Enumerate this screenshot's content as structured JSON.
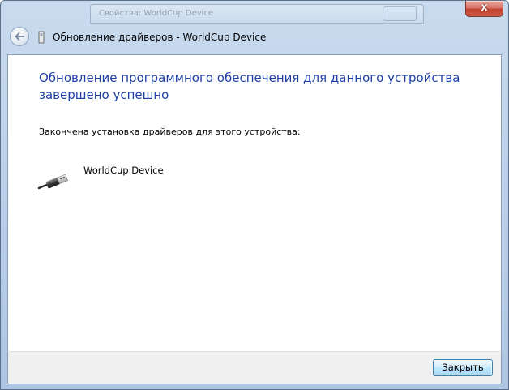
{
  "window": {
    "close_glyph": "x",
    "background_window_title": "Свойства: WorldCup Device"
  },
  "header": {
    "back_icon": "back-arrow-icon",
    "device_icon": "usb-device-icon",
    "title": "Обновление драйверов - WorldCup Device"
  },
  "main": {
    "heading": "Обновление программного обеспечения для данного устройства завершено успешно",
    "subtext": "Закончена установка драйверов для этого устройства:",
    "device": {
      "icon": "usb-plug-icon",
      "name": "WorldCup Device"
    }
  },
  "footer": {
    "close_label": "Закрыть"
  },
  "colors": {
    "heading": "#1e3fa8",
    "close_button": "#c2412f",
    "accent_button_border": "#3c7fb1"
  }
}
